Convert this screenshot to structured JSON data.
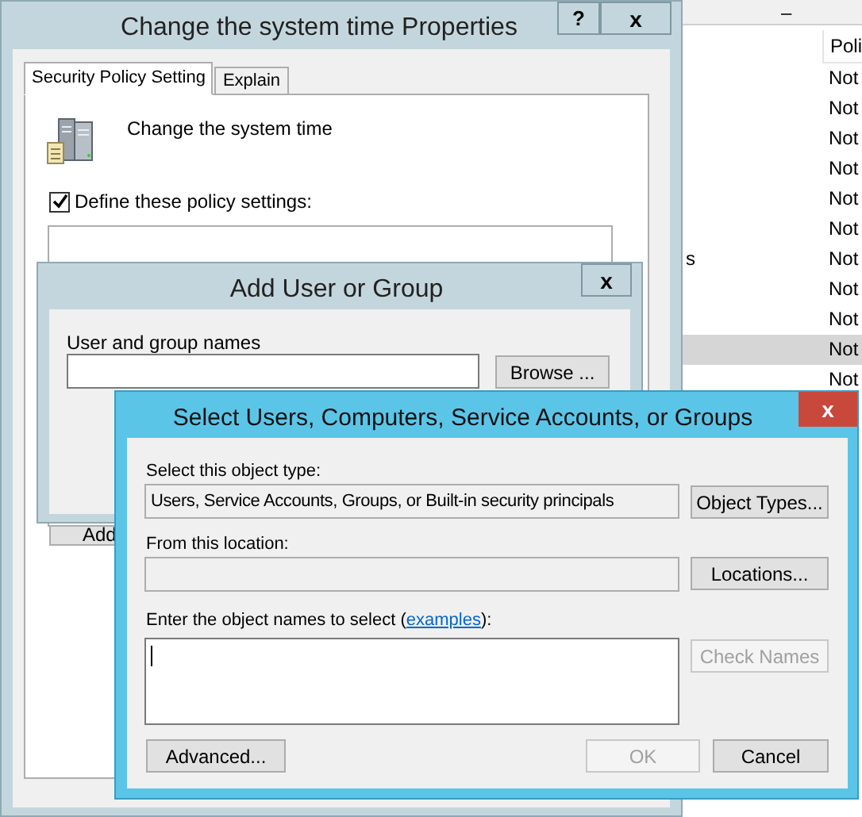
{
  "background_list": {
    "minimize_glyph": "–",
    "column_header": "Poli",
    "rows": [
      {
        "value": "Not",
        "selected": false
      },
      {
        "value": "Not",
        "selected": false
      },
      {
        "value": "Not",
        "selected": false
      },
      {
        "value": "Not",
        "selected": false
      },
      {
        "value": "Not",
        "selected": false
      },
      {
        "value": "Not",
        "selected": false
      },
      {
        "name": "s",
        "value": "Not",
        "selected": false
      },
      {
        "value": "Not",
        "selected": false
      },
      {
        "value": "Not",
        "selected": false
      },
      {
        "value": "Not",
        "selected": true
      },
      {
        "value": "Not",
        "selected": false
      }
    ]
  },
  "properties_window": {
    "title": "Change the system time Properties",
    "help_button": "?",
    "close_button": "x",
    "tabs": [
      {
        "label": "Security Policy Setting",
        "selected": true
      },
      {
        "label": "Explain",
        "selected": false
      }
    ],
    "policy_name": "Change the system time",
    "define_checkbox": {
      "label": "Define these policy settings:",
      "checked": true
    },
    "add_button": "Add"
  },
  "add_user_window": {
    "title": "Add User or Group",
    "close_button": "x",
    "names_label": "User and group names",
    "browse_button": "Browse ..."
  },
  "select_window": {
    "title": "Select Users, Computers, Service Accounts, or Groups",
    "close_button": "x",
    "object_type_label": "Select this object type:",
    "object_type_value": "Users, Service Accounts, Groups, or Built-in security principals",
    "object_types_button": "Object Types...",
    "location_label": "From this location:",
    "locations_button": "Locations...",
    "names_label": {
      "before": "Enter the object names to select (",
      "link": "examples",
      "after": "):"
    },
    "check_names_button": {
      "label": "Check Names",
      "disabled": true
    },
    "advanced_button": {
      "label": "Advanced...",
      "disabled": false
    },
    "ok_button": {
      "label": "OK",
      "disabled": true
    },
    "cancel_button": {
      "label": "Cancel",
      "disabled": false
    }
  }
}
